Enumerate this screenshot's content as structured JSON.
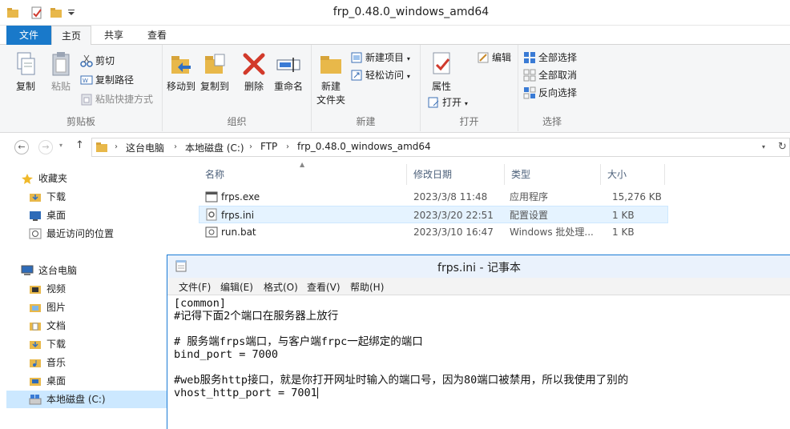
{
  "window": {
    "title": "frp_0.48.0_windows_amd64"
  },
  "ribbon_tabs": [
    "文件",
    "主页",
    "共享",
    "查看"
  ],
  "ribbon": {
    "clipboard": {
      "label": "剪贴板",
      "copy": "复制",
      "paste": "粘贴",
      "cut": "剪切",
      "copy_path": "复制路径",
      "paste_shortcut": "粘贴快捷方式"
    },
    "organize": {
      "label": "组织",
      "move_to": "移动到",
      "copy_to": "复制到",
      "delete": "删除",
      "rename": "重命名"
    },
    "new": {
      "label": "新建",
      "new_folder": "新建\n文件夹",
      "new_folder_l1": "新建",
      "new_folder_l2": "文件夹",
      "new_item": "新建项目",
      "easy_access": "轻松访问"
    },
    "open": {
      "label": "打开",
      "properties": "属性",
      "open": "打开",
      "edit": "编辑"
    },
    "select": {
      "label": "选择",
      "select_all": "全部选择",
      "select_none": "全部取消",
      "invert": "反向选择"
    }
  },
  "address": {
    "crumbs": [
      "这台电脑",
      "本地磁盘 (C:)",
      "FTP",
      "frp_0.48.0_windows_amd64"
    ]
  },
  "nav_pane": {
    "favorites": "收藏夹",
    "favorites_items": [
      "下载",
      "桌面",
      "最近访问的位置"
    ],
    "this_pc": "这台电脑",
    "pc_items": [
      "视频",
      "图片",
      "文档",
      "下载",
      "音乐",
      "桌面",
      "本地磁盘 (C:)"
    ]
  },
  "file_list": {
    "headers": {
      "name": "名称",
      "modified": "修改日期",
      "type": "类型",
      "size": "大小"
    },
    "rows": [
      {
        "name": "frps.exe",
        "modified": "2023/3/8 11:48",
        "type": "应用程序",
        "size": "15,276 KB",
        "icon": "exe-icon"
      },
      {
        "name": "frps.ini",
        "modified": "2023/3/20 22:51",
        "type": "配置设置",
        "size": "1 KB",
        "icon": "ini-icon"
      },
      {
        "name": "run.bat",
        "modified": "2023/3/10 16:47",
        "type": "Windows 批处理...",
        "size": "1 KB",
        "icon": "bat-icon"
      }
    ]
  },
  "notepad": {
    "title": "frps.ini - 记事本",
    "menu": [
      "文件(F)",
      "编辑(E)",
      "格式(O)",
      "查看(V)",
      "帮助(H)"
    ],
    "lines": [
      "[common]",
      "#记得下面2个端口在服务器上放行",
      "",
      "# 服务端frps端口，与客户端frpc一起绑定的端口",
      "bind_port = 7000",
      "",
      "#web服务http接口，就是你打开网址时输入的端口号，因为80端口被禁用，所以我使用了别的",
      "vhost_http_port = 7001"
    ]
  },
  "colors": {
    "accent": "#1979ca",
    "selected_row": "#e5f3ff",
    "notepad_border": "#1a7bd6"
  }
}
